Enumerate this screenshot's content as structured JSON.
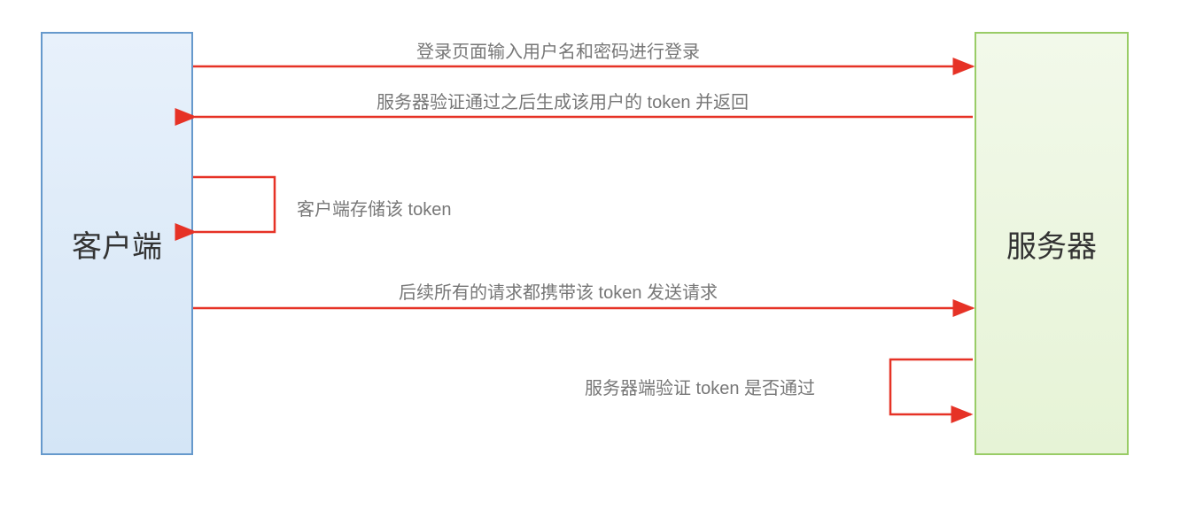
{
  "client": {
    "label": "客户端"
  },
  "server": {
    "label": "服务器"
  },
  "messages": {
    "login": "登录页面输入用户名和密码进行登录",
    "token_return": "服务器验证通过之后生成该用户的 token 并返回",
    "store_token": "客户端存储该 token",
    "request_with_token": "后续所有的请求都携带该 token 发送请求",
    "verify_token": "服务器端验证 token 是否通过"
  },
  "chart_data": {
    "type": "sequence",
    "actors": [
      "客户端",
      "服务器"
    ],
    "steps": [
      {
        "from": "客户端",
        "to": "服务器",
        "label": "登录页面输入用户名和密码进行登录"
      },
      {
        "from": "服务器",
        "to": "客户端",
        "label": "服务器验证通过之后生成该用户的 token 并返回"
      },
      {
        "from": "客户端",
        "to": "客户端",
        "label": "客户端存储该 token"
      },
      {
        "from": "客户端",
        "to": "服务器",
        "label": "后续所有的请求都携带该 token 发送请求"
      },
      {
        "from": "服务器",
        "to": "服务器",
        "label": "服务器端验证 token 是否通过"
      }
    ]
  }
}
